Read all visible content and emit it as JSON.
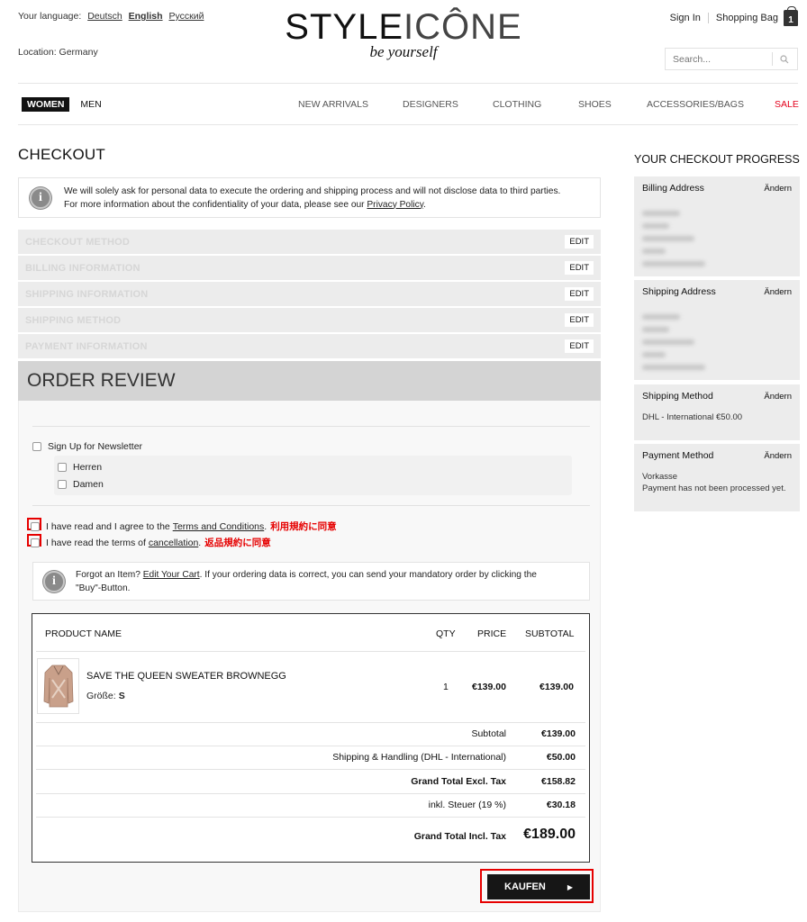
{
  "header": {
    "language_label": "Your language:",
    "languages": [
      {
        "label": "Deutsch",
        "active": false
      },
      {
        "label": "English",
        "active": true
      },
      {
        "label": "Русский",
        "active": false
      }
    ],
    "location": "Location: Germany",
    "logo_left": "STYLE",
    "logo_right": "ICÔNE",
    "tagline": "be yourself",
    "sign_in": "Sign In",
    "shopping_bag": "Shopping Bag",
    "bag_count": "1",
    "search_placeholder": "Search..."
  },
  "nav": {
    "women": "WOMEN",
    "men": "MEN",
    "items": [
      "NEW ARRIVALS",
      "DESIGNERS",
      "CLOTHING",
      "SHOES",
      "ACCESSORIES/BAGS",
      "SALE"
    ]
  },
  "checkout": {
    "title": "CHECKOUT",
    "info_line1": "We will solely ask for personal data to execute the ordering and shipping process and will not disclose data to third parties.",
    "info_line2_prefix": "For more information about the confidentiality of your data, please see our ",
    "privacy_link": "Privacy Policy",
    "info_line2_suffix": ".",
    "steps": [
      {
        "name": "CHECKOUT METHOD",
        "edit": "EDIT"
      },
      {
        "name": "BILLING INFORMATION",
        "edit": "EDIT"
      },
      {
        "name": "SHIPPING INFORMATION",
        "edit": "EDIT"
      },
      {
        "name": "SHIPPING METHOD",
        "edit": "EDIT"
      },
      {
        "name": "PAYMENT INFORMATION",
        "edit": "EDIT"
      }
    ],
    "review_title": "ORDER REVIEW"
  },
  "newsletter": {
    "label": "Sign Up for Newsletter",
    "options": [
      "Herren",
      "Damen"
    ]
  },
  "agreements": {
    "terms_prefix": "I have read and I agree to the ",
    "terms_link": "Terms and Conditions",
    "terms_suffix": ".",
    "terms_note": "利用規約に同意",
    "cancel_prefix": "I have read the terms of ",
    "cancel_link": "cancellation",
    "cancel_suffix": ".",
    "cancel_note": "返品規約に同意"
  },
  "forgot": {
    "prefix": "Forgot an Item? ",
    "link": "Edit Your Cart",
    "suffix": ". If your ordering data is correct, you can send your mandatory order by clicking the",
    "line2": "\"Buy\"-Button."
  },
  "order_table": {
    "headers": {
      "product": "PRODUCT NAME",
      "qty": "QTY",
      "price": "PRICE",
      "subtotal": "SUBTOTAL"
    },
    "item": {
      "name": "SAVE THE QUEEN SWEATER BROWNEGG",
      "size_label": "Größe:",
      "size_value": "S",
      "qty": "1",
      "price": "€139.00",
      "subtotal": "€139.00"
    },
    "totals": [
      {
        "label": "Subtotal",
        "value": "€139.00"
      },
      {
        "label": "Shipping & Handling (DHL - International)",
        "value": "€50.00"
      },
      {
        "label": "Grand Total Excl. Tax",
        "value": "€158.82"
      },
      {
        "label": "inkl. Steuer (19 %)",
        "value": "€30.18"
      },
      {
        "label": "Grand Total Incl. Tax",
        "value": "€189.00"
      }
    ]
  },
  "buy_button": "KAUFEN",
  "sidebar": {
    "title": "YOUR CHECKOUT PROGRESS",
    "change_label": "Ändern",
    "billing_address": "Billing Address",
    "shipping_address": "Shipping Address",
    "shipping_method": "Shipping Method",
    "shipping_method_value": "DHL - International €50.00",
    "payment_method": "Payment Method",
    "payment_line1": "Vorkasse",
    "payment_line2": "Payment has not been processed yet."
  },
  "colors": {
    "accent_red": "#e60000",
    "sale_red": "#e3001b",
    "dark": "#161616"
  }
}
